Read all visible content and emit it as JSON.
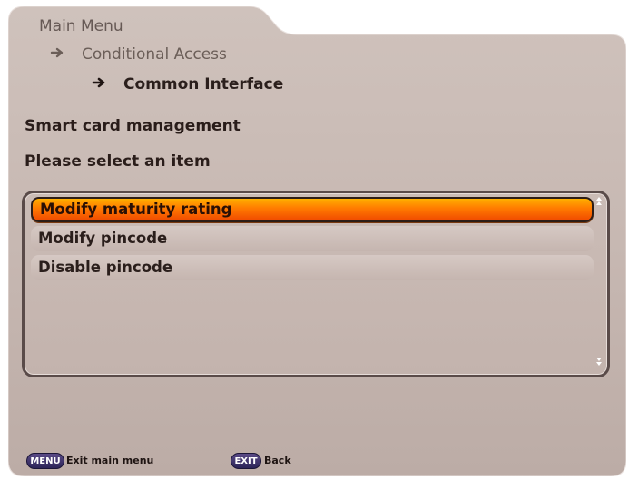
{
  "breadcrumb": {
    "root": "Main Menu",
    "level1": "Conditional Access",
    "level2": "Common Interface"
  },
  "page": {
    "title": "Smart card management",
    "subtitle": "Please select an item"
  },
  "menu": {
    "items": [
      {
        "label": "Modify maturity rating",
        "selected": true
      },
      {
        "label": "Modify pincode",
        "selected": false
      },
      {
        "label": "Disable pincode",
        "selected": false
      }
    ]
  },
  "footer": {
    "menu_key": "MENU",
    "menu_action": "Exit main menu",
    "exit_key": "EXIT",
    "exit_action": "Back"
  },
  "icons": {
    "breadcrumb_arrow": "arrow-right-icon",
    "scroll_up": "scroll-up-icon",
    "scroll_down": "scroll-down-icon"
  },
  "colors": {
    "panel": "#c6b7b1",
    "selection": "#ff7a00",
    "key_badge": "#3a2f6e"
  }
}
